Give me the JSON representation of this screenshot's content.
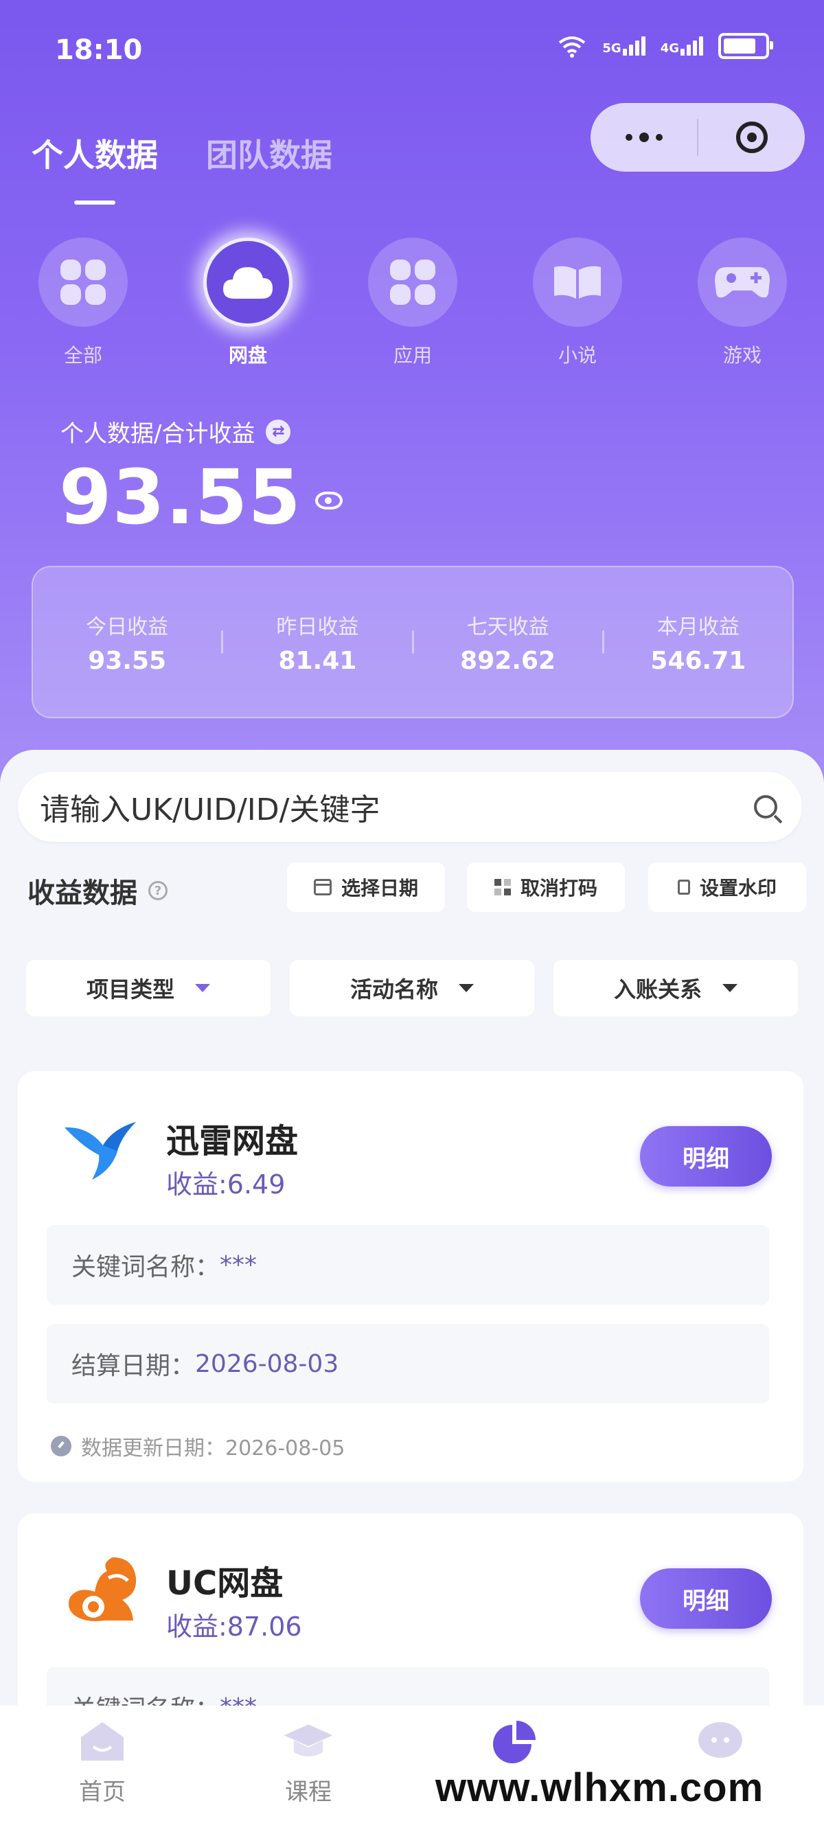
{
  "status": {
    "time": "18:10",
    "net1": "5G",
    "net2": "4G"
  },
  "tabs": [
    "个人数据",
    "团队数据"
  ],
  "categories": [
    {
      "label": "全部",
      "icon": "grid-icon"
    },
    {
      "label": "网盘",
      "icon": "cloud-icon"
    },
    {
      "label": "应用",
      "icon": "apps-icon"
    },
    {
      "label": "小说",
      "icon": "book-icon"
    },
    {
      "label": "游戏",
      "icon": "gamepad-icon"
    }
  ],
  "summary": {
    "label": "个人数据/合计收益",
    "value": "93.55"
  },
  "stats": [
    {
      "label": "今日收益",
      "value": "93.55"
    },
    {
      "label": "昨日收益",
      "value": "81.41"
    },
    {
      "label": "七天收益",
      "value": "892.62"
    },
    {
      "label": "本月收益",
      "value": "546.71"
    }
  ],
  "search": {
    "placeholder": "请输入UK/UID/ID/关键字"
  },
  "section": {
    "title": "收益数据",
    "select_date": "选择日期",
    "cancel_mosaic": "取消打码",
    "set_watermark": "设置水印"
  },
  "filters": [
    "项目类型",
    "活动名称",
    "入账关系"
  ],
  "cards": [
    {
      "name": "迅雷网盘",
      "earn": "收益:6.49",
      "button": "明细",
      "keyword_label": "关键词名称：",
      "keyword_value": "***",
      "date_label": "结算日期：",
      "date_value": "2026-08-03",
      "update": "数据更新日期：2026-08-05"
    },
    {
      "name": "UC网盘",
      "earn": "收益:87.06",
      "button": "明细",
      "keyword_label": "关键词名称：",
      "keyword_value": "***"
    }
  ],
  "tabbar": [
    {
      "label": "首页",
      "icon": "home-icon"
    },
    {
      "label": "课程",
      "icon": "course-icon"
    },
    {
      "label": "",
      "icon": "data-pie-icon"
    },
    {
      "label": "",
      "icon": "chat-icon"
    }
  ],
  "watermark": "www.wlhxm.com",
  "colors": {
    "brand": "#7b58ee",
    "accent_text": "#6a5bb8"
  }
}
